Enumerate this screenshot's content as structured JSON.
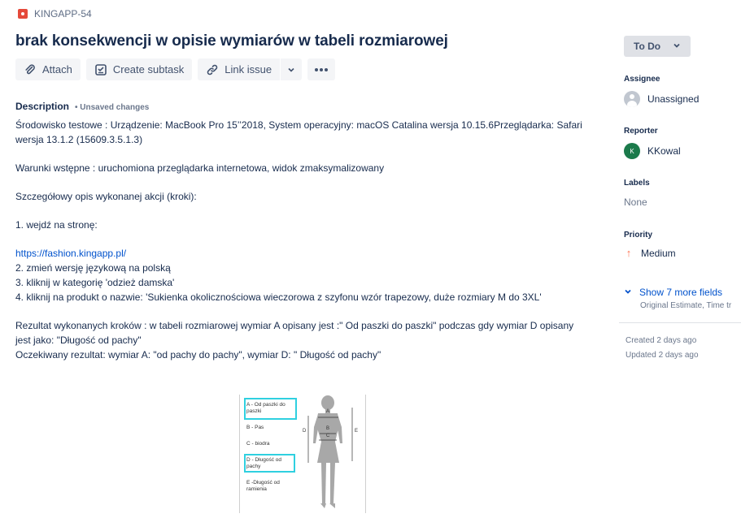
{
  "issue": {
    "key": "KINGAPP-54",
    "title": "brak konsekwencji w opisie wymiarów w tabeli rozmiarowej"
  },
  "toolbar": {
    "attach_label": "Attach",
    "create_subtask_label": "Create subtask",
    "link_issue_label": "Link issue"
  },
  "description": {
    "label": "Description",
    "unsaved_label": "• Unsaved changes",
    "lines": [
      "Środowisko testowe : Urządzenie: MacBook Pro 15’’2018, System operacyjny: macOS Catalina wersja 10.15.6Przeglądarka: Safari wersja 13.1.2 (15609.3.5.1.3)",
      "Warunki wstępne : uruchomiona przeglądarka internetowa, widok zmaksymalizowany",
      "Szczegółowy opis wykonanej akcji (kroki):",
      "1. wejdź na stronę:",
      "https://fashion.kingapp.pl/",
      "2. zmień wersję językową na polską",
      "3. kliknij w kategorię 'odzież damska'",
      "4. kliknij na produkt o nazwie: 'Sukienka okolicznościowa wieczorowa z szyfonu wzór trapezowy, duże rozmiary M do 3XL'",
      "Rezultat wykonanych kroków : w tabeli rozmiarowej wymiar A opisany jest :\" Od paszki do paszki\" podczas gdy wymiar D opisany jest jako: \"Długość od pachy\"",
      "Oczekiwany rezultat: wymiar A: \"od pachy do pachy\", wymiar D: \" Długość od pachy\""
    ]
  },
  "figure": {
    "labels": [
      "A - Od paszki do paszki",
      "B - Pas",
      "C - biodra",
      "D - Długość od pachy",
      "E -Długość od ramienia"
    ],
    "letters": [
      "A",
      "B",
      "C",
      "D",
      "E"
    ]
  },
  "sidebar": {
    "status": "To Do",
    "assignee_label": "Assignee",
    "assignee_value": "Unassigned",
    "reporter_label": "Reporter",
    "reporter_initial": "K",
    "reporter_value": "KKowal",
    "labels_label": "Labels",
    "labels_value": "None",
    "priority_label": "Priority",
    "priority_value": "Medium",
    "show_more": "Show 7 more fields",
    "show_more_sub": "Original Estimate, Time tr",
    "created": "Created 2 days ago",
    "updated": "Updated 2 days ago"
  },
  "colors": {
    "bug": "#e5493a",
    "link": "#0052cc",
    "priority_medium": "#ff7452",
    "highlight_box": "#2fd0e0",
    "reporter_avatar": "#1b7a4b"
  },
  "icons": [
    "bug-icon",
    "paperclip-icon",
    "subtask-icon",
    "link-icon",
    "chevron-down-icon",
    "more-icon",
    "user-avatar-icon",
    "arrow-up-icon",
    "chevron-down-icon"
  ]
}
